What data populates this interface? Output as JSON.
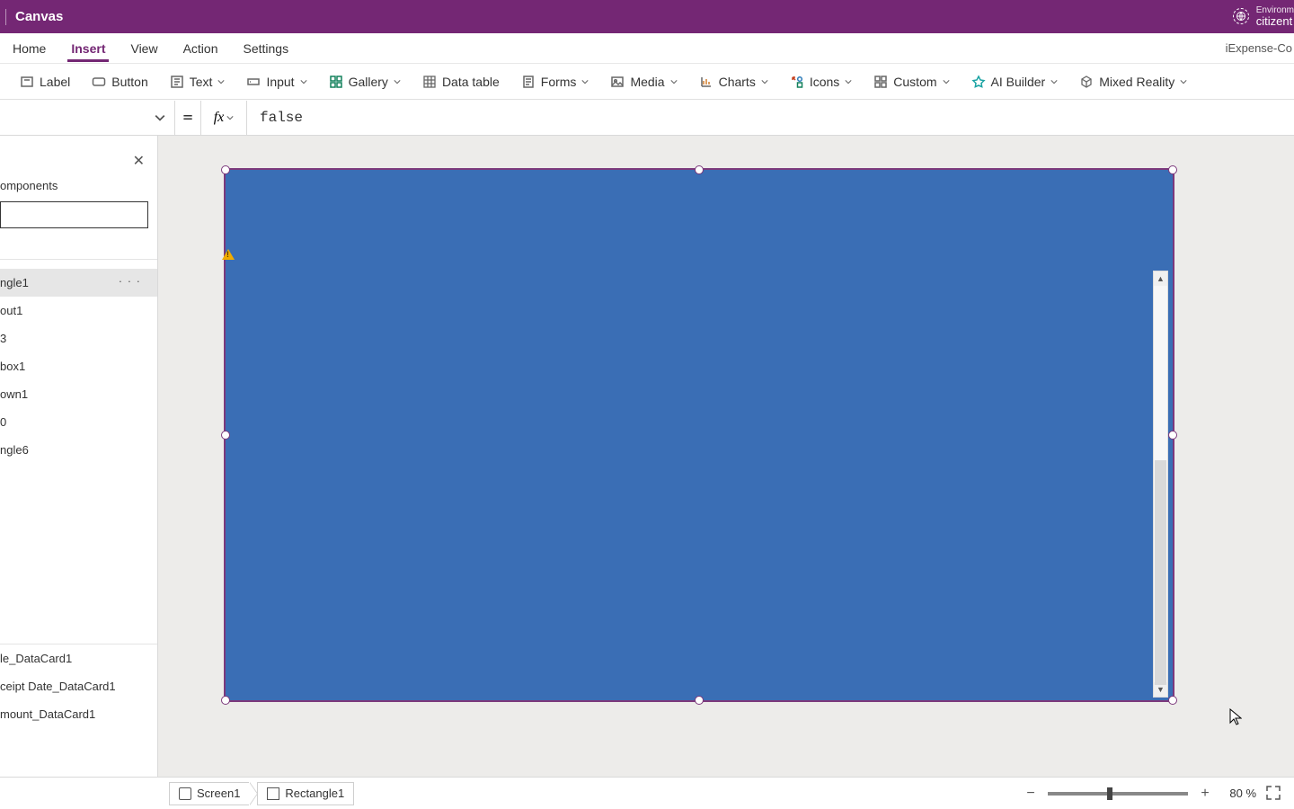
{
  "titlebar": {
    "title": "Canvas",
    "env_label": "Environm",
    "env_name": "citizent"
  },
  "menutabs": {
    "items": [
      "Home",
      "Insert",
      "View",
      "Action",
      "Settings"
    ],
    "active_index": 1,
    "app_name": "iExpense-Co"
  },
  "ribbon": {
    "label_btn": "Label",
    "button_btn": "Button",
    "text_btn": "Text",
    "input_btn": "Input",
    "gallery_btn": "Gallery",
    "datatable_btn": "Data table",
    "forms_btn": "Forms",
    "media_btn": "Media",
    "charts_btn": "Charts",
    "icons_btn": "Icons",
    "custom_btn": "Custom",
    "ai_builder_btn": "AI Builder",
    "mixed_reality_btn": "Mixed Reality"
  },
  "formula_bar": {
    "property": "",
    "equals": "=",
    "fx": "fx",
    "value": "false"
  },
  "tree": {
    "header": "omponents",
    "search_value": "",
    "items": [
      "ngle1",
      "out1",
      "3",
      "box1",
      "own1",
      "0",
      "ngle6"
    ],
    "selected_index": 0,
    "bottom_items": [
      "le_DataCard1",
      "ceipt Date_DataCard1",
      "mount_DataCard1"
    ]
  },
  "canvas": {
    "rect_color": "#3a6eb5"
  },
  "status": {
    "crumb1": "Screen1",
    "crumb2": "Rectangle1",
    "zoom_value": "80",
    "zoom_pct": "%"
  }
}
